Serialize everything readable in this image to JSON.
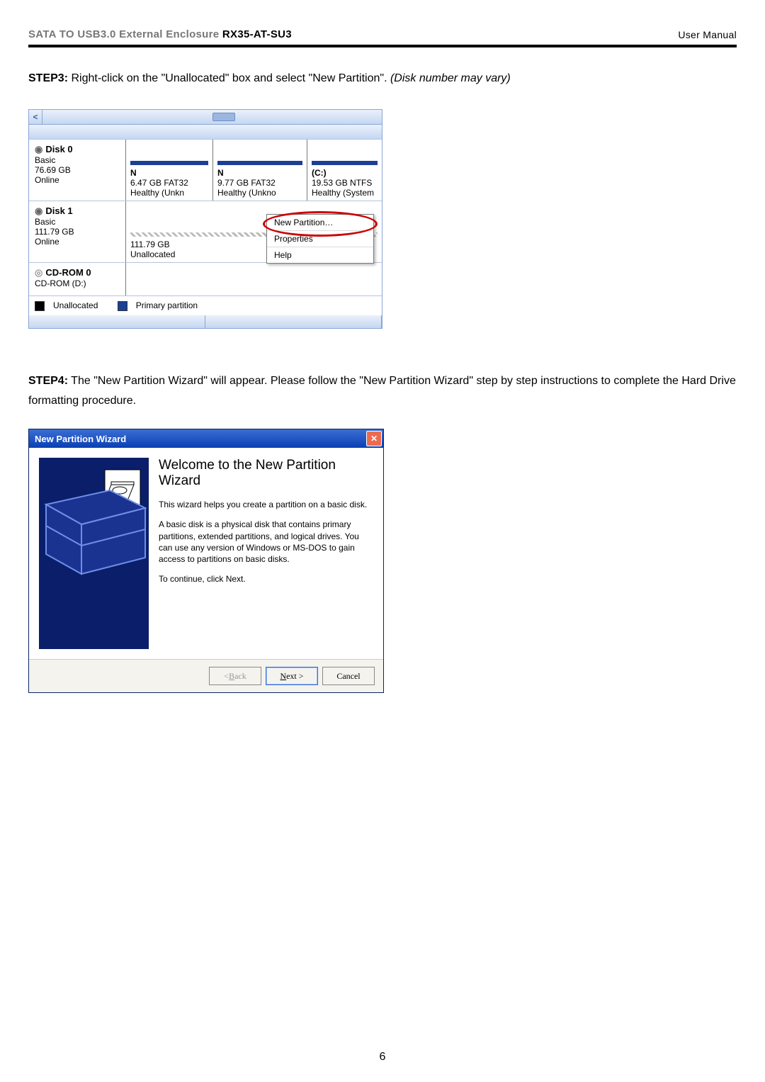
{
  "header": {
    "left_prefix": "SATA TO USB3.0 External Enclosure ",
    "model": "RX35-AT-SU3",
    "right": "User Manual"
  },
  "step3": {
    "label": "STEP3:",
    "text": "  Right-click on the \"Unallocated\" box and select \"New Partition\". ",
    "italic": "(Disk number may vary)"
  },
  "dm": {
    "scroll_arrow": "<",
    "disk0": {
      "title": "Disk 0",
      "l1": "Basic",
      "l2": "76.69 GB",
      "l3": "Online",
      "p1": {
        "name": "N",
        "line1": "6.47 GB FAT32",
        "line2": "Healthy (Unkn"
      },
      "p2": {
        "name": "N",
        "line1": "9.77 GB FAT32",
        "line2": "Healthy (Unkno"
      },
      "p3": {
        "name": "(C:)",
        "line1": "19.53 GB NTFS",
        "line2": "Healthy (System"
      }
    },
    "disk1": {
      "title": "Disk 1",
      "l1": "Basic",
      "l2": "111.79 GB",
      "l3": "Online",
      "unalloc": {
        "line1": "111.79 GB",
        "line2": "Unallocated"
      }
    },
    "cd": {
      "title": "CD-ROM 0",
      "sub": "CD-ROM (D:)"
    },
    "menu": {
      "item1": "New Partition…",
      "item2": "Properties",
      "item3": "Help"
    },
    "legend": {
      "a": "Unallocated",
      "b": "Primary partition"
    }
  },
  "step4": {
    "label": "STEP4:",
    "text": "  The \"New Partition Wizard\" will appear.   Please follow the \"New Partition Wizard\" step by step instructions to complete the Hard Drive formatting procedure."
  },
  "wizard": {
    "title": "New Partition Wizard",
    "heading": "Welcome to the New Partition Wizard",
    "p1": "This wizard helps you create a partition on a basic disk.",
    "p2": "A basic disk is a physical disk that contains primary partitions, extended partitions, and logical drives. You can use any version of Windows or MS-DOS to gain access to partitions on basic disks.",
    "p3": "To continue, click Next.",
    "back": "< Back",
    "next": "Next >",
    "cancel": "Cancel"
  },
  "page_number": "6"
}
